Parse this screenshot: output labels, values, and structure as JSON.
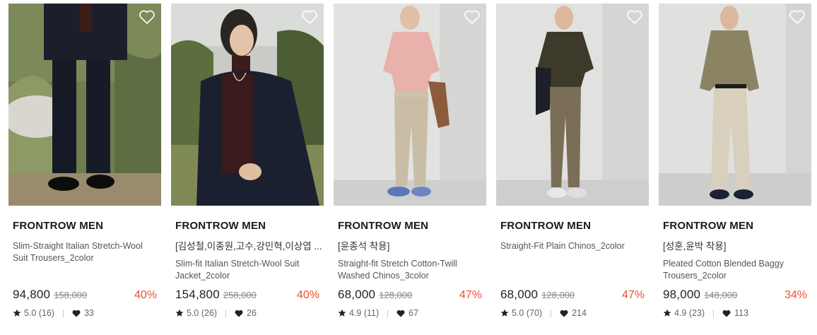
{
  "products": [
    {
      "brand": "FRONTROW MEN",
      "subtitle": "",
      "name": "Slim-Straight Italian Stretch-Wool Suit Trousers_2color",
      "price": "94,800",
      "original_price": "158,000",
      "discount": "40%",
      "rating": "5.0 (16)",
      "likes": "33",
      "photo": "model-navy-trousers-grass"
    },
    {
      "brand": "FRONTROW MEN",
      "subtitle": "[김성철,이종원,고수,강민혁,이상엽 ...",
      "name": "Slim-fit Italian Stretch-Wool Suit Jacket_2color",
      "price": "154,800",
      "original_price": "258,000",
      "discount": "40%",
      "rating": "5.0 (26)",
      "likes": "26",
      "photo": "model-navy-jacket-outdoor"
    },
    {
      "brand": "FRONTROW MEN",
      "subtitle": "[윤종석 착용]",
      "name": "Straight-fit Stretch Cotton-Twill Washed Chinos_3color",
      "price": "68,000",
      "original_price": "128,000",
      "discount": "47%",
      "rating": "4.9 (11)",
      "likes": "67",
      "photo": "model-beige-chinos-pink-tee"
    },
    {
      "brand": "FRONTROW MEN",
      "subtitle": "",
      "name": "Straight-Fit Plain Chinos_2color",
      "price": "68,000",
      "original_price": "128,000",
      "discount": "47%",
      "rating": "5.0 (70)",
      "likes": "214",
      "photo": "model-olive-chinos-dark-tee"
    },
    {
      "brand": "FRONTROW MEN",
      "subtitle": "[성훈,윤박 착용]",
      "name": "Pleated Cotton Blended Baggy Trousers_2color",
      "price": "98,000",
      "original_price": "148,000",
      "discount": "34%",
      "rating": "4.9 (23)",
      "likes": "113",
      "photo": "model-cream-baggy-trousers"
    }
  ],
  "icons": {
    "wishlist": "heart-outline-icon",
    "rating": "star-icon",
    "likes": "heart-icon"
  },
  "colors": {
    "discount": "#f0502c",
    "price": "#222222",
    "original_price": "#888888"
  }
}
